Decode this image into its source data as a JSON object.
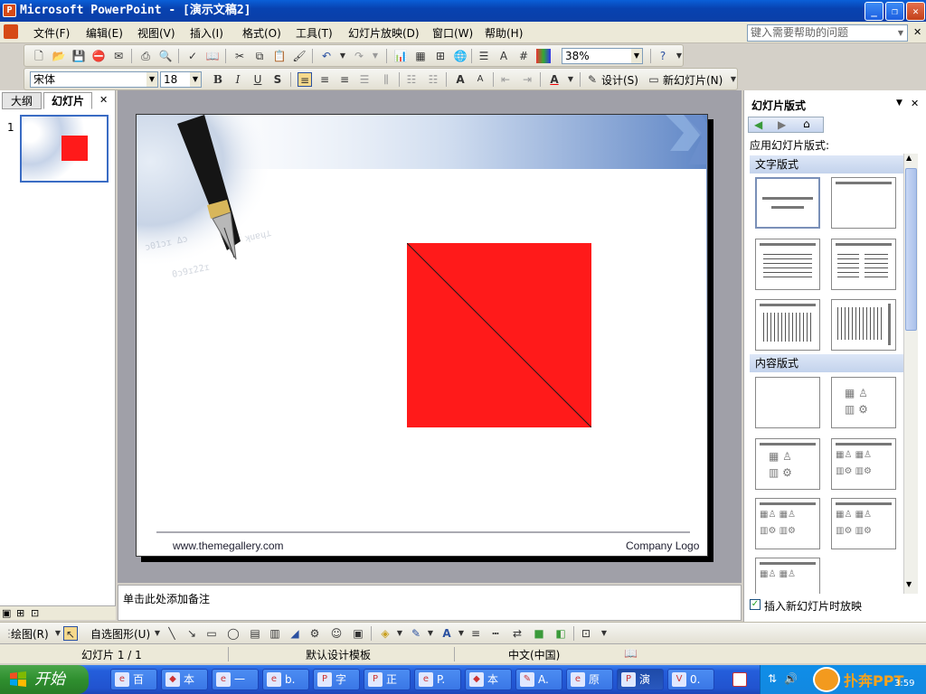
{
  "window": {
    "title": "Microsoft PowerPoint - [演示文稿2]",
    "min": "_",
    "restore": "❐",
    "close": "✕"
  },
  "menu": {
    "items": [
      "文件(F)",
      "编辑(E)",
      "视图(V)",
      "插入(I)",
      "格式(O)",
      "工具(T)",
      "幻灯片放映(D)",
      "窗口(W)",
      "帮助(H)"
    ],
    "help_placeholder": "键入需要帮助的问题",
    "close": "✕"
  },
  "toolbar_std": {
    "zoom": "38%"
  },
  "toolbar_fmt": {
    "font": "宋体",
    "size": "18",
    "bold": "B",
    "italic": "I",
    "underline": "U",
    "shadow": "S",
    "design": "设计(S)",
    "new_slide": "新幻灯片(N)"
  },
  "left_pane": {
    "tab_outline": "大纲",
    "tab_slides": "幻灯片",
    "close": "✕",
    "slide_number": "1"
  },
  "slide": {
    "footer_left": "www.themegallery.com",
    "footer_right": "Company Logo",
    "shape_color": "#ff1a1a"
  },
  "notes": {
    "placeholder": "单击此处添加备注"
  },
  "task_pane": {
    "title": "幻灯片版式",
    "apply_label": "应用幻灯片版式:",
    "section_text": "文字版式",
    "section_content": "内容版式",
    "show_on_insert": "插入新幻灯片时放映"
  },
  "drawing_bar": {
    "draw": "绘图(R)",
    "autoshapes": "自选图形(U)"
  },
  "status": {
    "slide": "幻灯片 1 / 1",
    "template": "默认设计模板",
    "language": "中文(中国)"
  },
  "taskbar": {
    "start": "开始",
    "tasks": [
      "百",
      "本",
      "一",
      "b.",
      "字",
      "正",
      "P.",
      "本",
      "A.",
      "原",
      "演",
      "0."
    ],
    "time": "3:59",
    "watermark": "扑奔PPT"
  }
}
